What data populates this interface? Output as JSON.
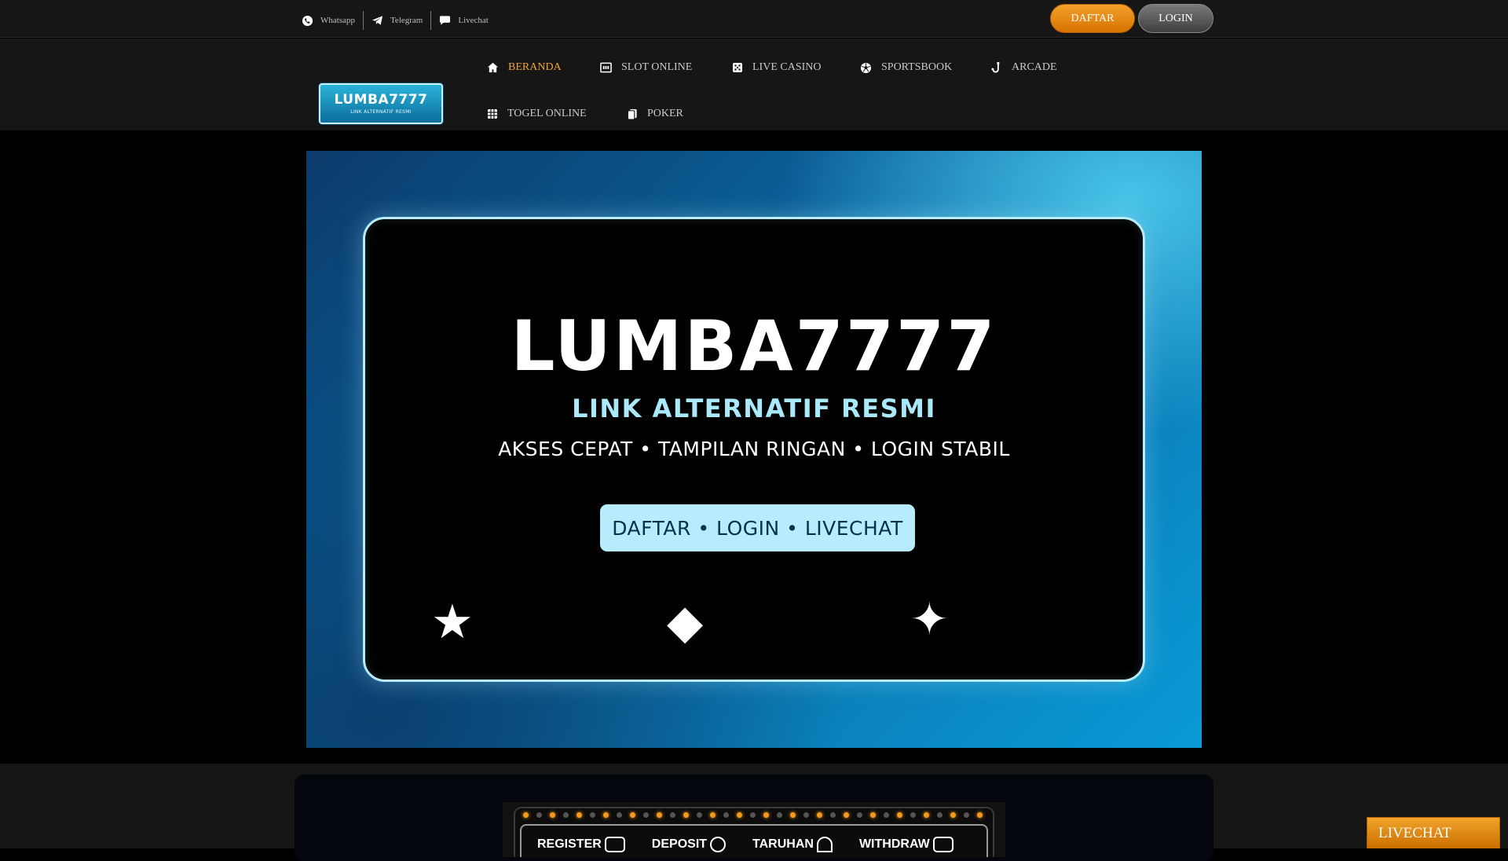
{
  "topbar": {
    "contacts": [
      {
        "label": "Whatsapp",
        "icon": "whatsapp-icon"
      },
      {
        "label": "Telegram",
        "icon": "telegram-icon"
      },
      {
        "label": "Livechat",
        "icon": "chat-bubble-icon"
      }
    ],
    "daftar_label": "DAFTAR",
    "login_label": "LOGIN"
  },
  "logo": {
    "main": "LUMBA7777",
    "sub": "LINK ALTERNATIF RESMI"
  },
  "nav": {
    "items": [
      {
        "label": "BERANDA",
        "icon": "home-icon",
        "active": true
      },
      {
        "label": "SLOT ONLINE",
        "icon": "slot-machine-icon"
      },
      {
        "label": "LIVE CASINO",
        "icon": "dice-icon"
      },
      {
        "label": "SPORTSBOOK",
        "icon": "soccer-ball-icon"
      },
      {
        "label": "ARCADE",
        "icon": "fishing-hook-icon"
      },
      {
        "label": "TOGEL ONLINE",
        "icon": "grid-icon"
      },
      {
        "label": "POKER",
        "icon": "playing-cards-icon"
      }
    ],
    "active_color": "#f0a33a"
  },
  "hero": {
    "title": "LUMBA7777",
    "subtitle": "LINK ALTERNATIF RESMI",
    "tagline": "AKSES CEPAT • TAMPILAN RINGAN • LOGIN STABIL",
    "cta": "DAFTAR • LOGIN • LIVECHAT",
    "glyphs": [
      "★",
      "◆",
      "✦"
    ]
  },
  "promo": {
    "steps": [
      "REGISTER",
      "DEPOSIT",
      "TARUHAN",
      "WITHDRAW"
    ]
  },
  "floating": {
    "livechat_label": "LIVECHAT"
  },
  "colors": {
    "accent_orange": "#f0a33a",
    "hero_cyan": "#b6ecfb",
    "page_bg": "#000000"
  }
}
